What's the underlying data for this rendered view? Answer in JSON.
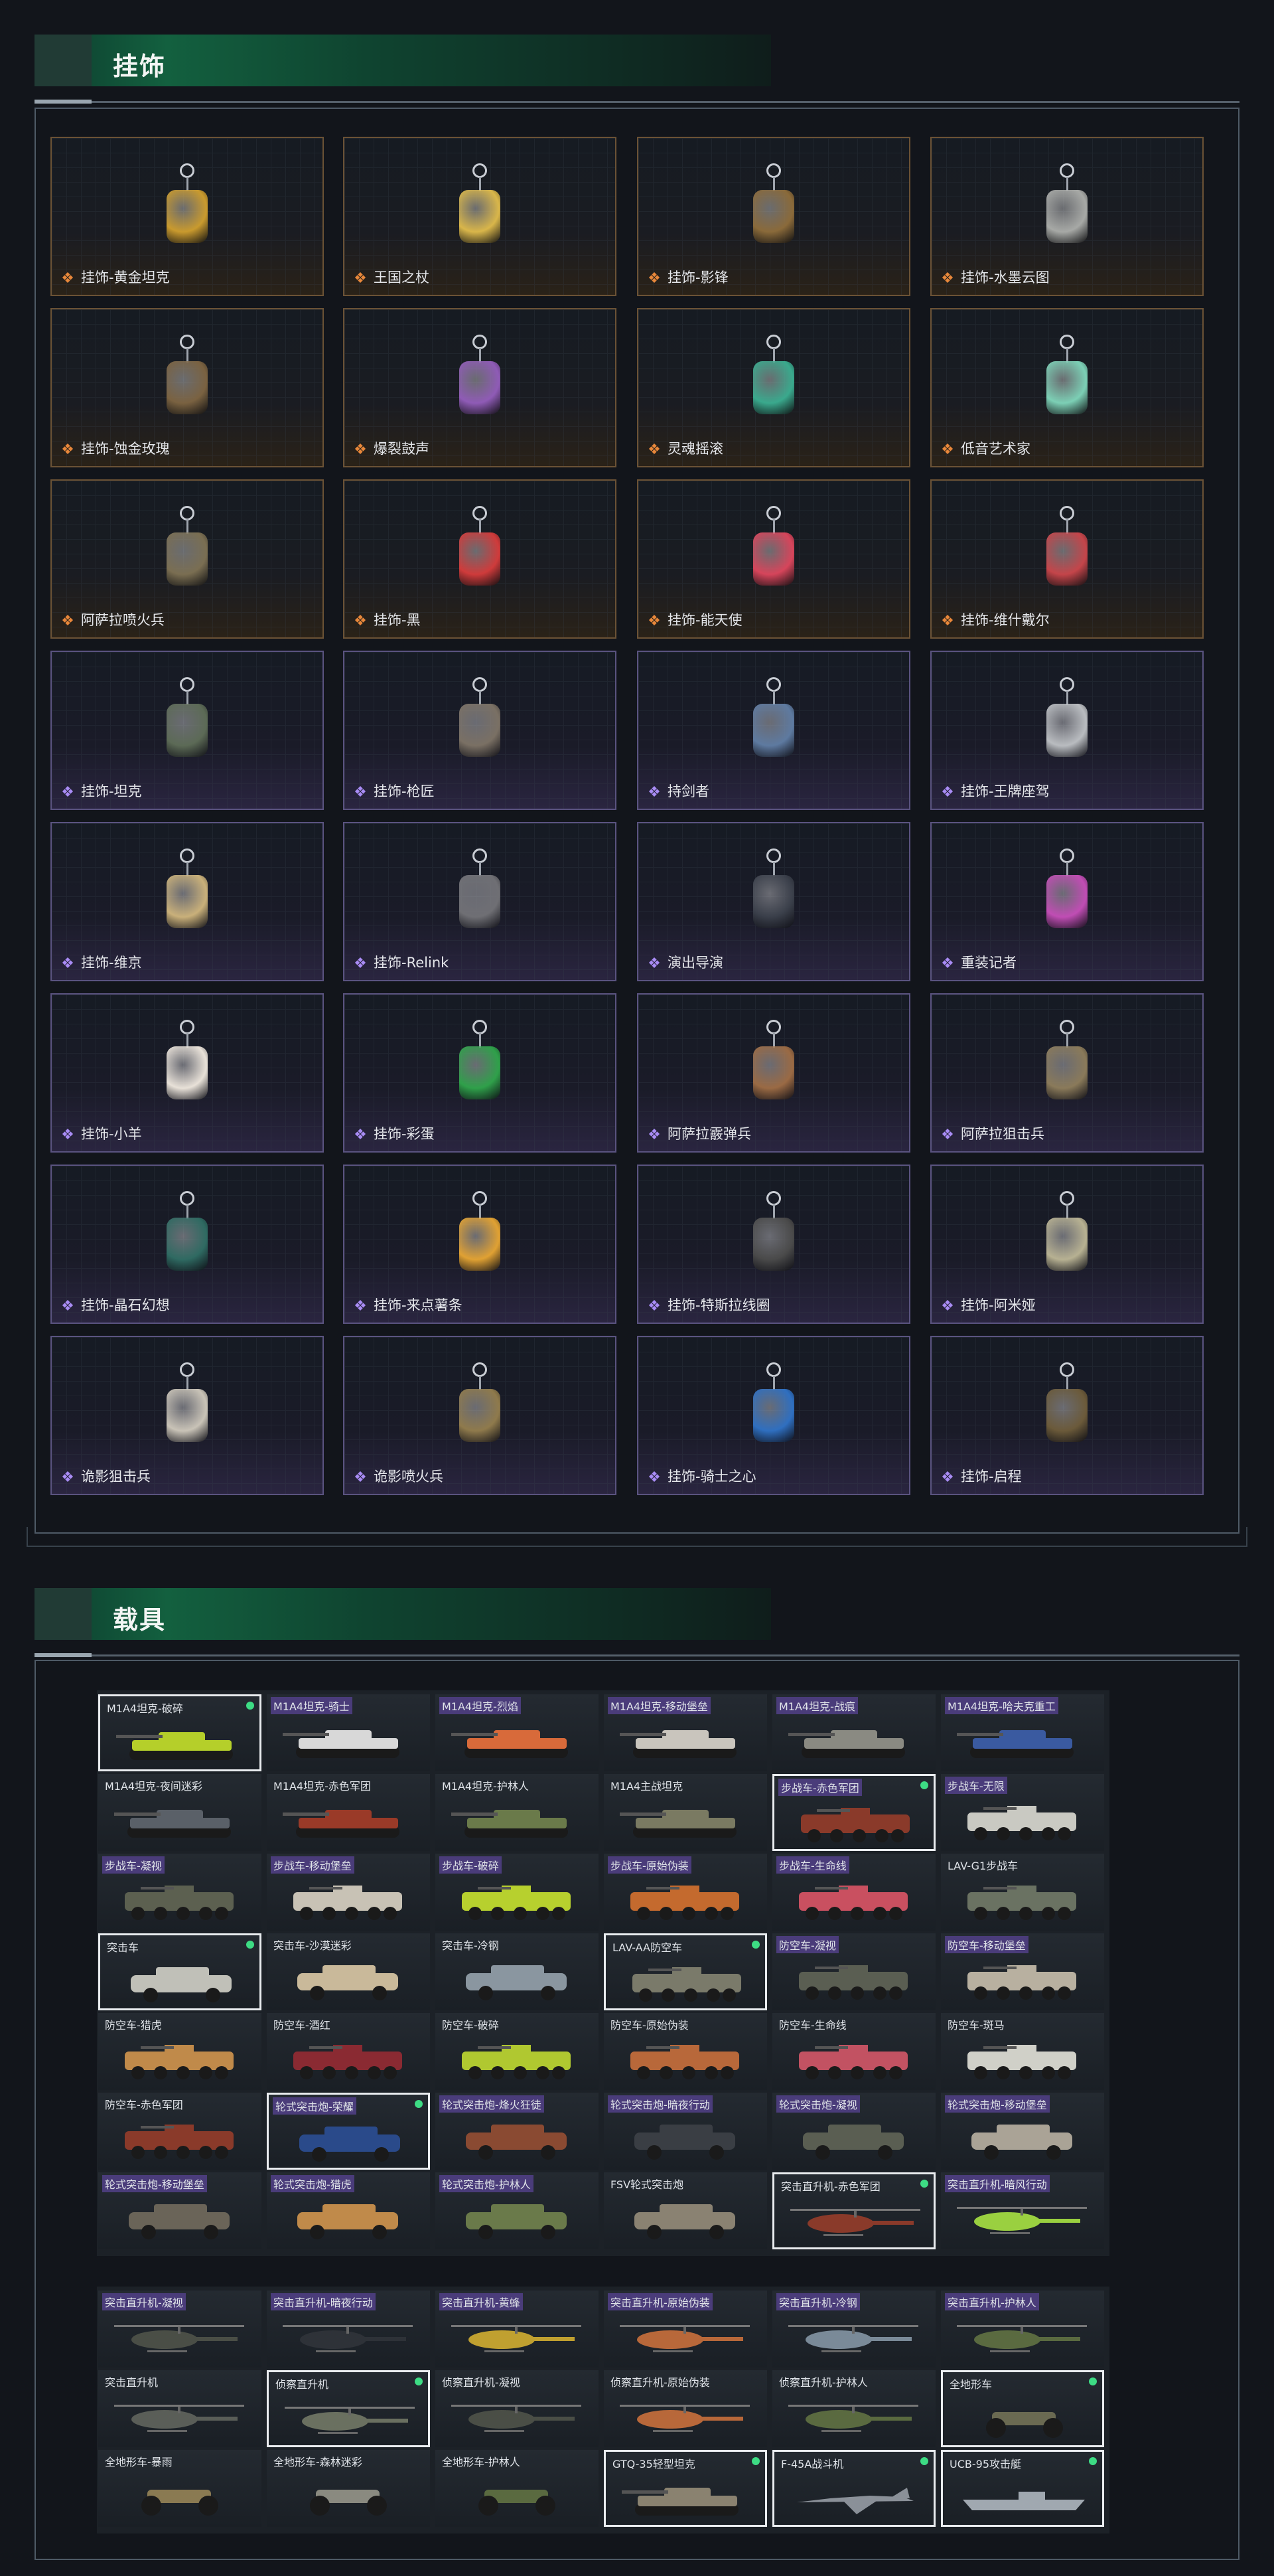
{
  "pendant_section": {
    "title": "挂饰",
    "items": [
      {
        "label": "挂饰-黄金坦克",
        "rarity": "orange",
        "charm": "#c99a2e"
      },
      {
        "label": "王国之杖",
        "rarity": "orange",
        "charm": "#d9b64a"
      },
      {
        "label": "挂饰-影锋",
        "rarity": "orange",
        "charm": "#8a6a3a"
      },
      {
        "label": "挂饰-水墨云图",
        "rarity": "orange",
        "charm": "#a7a9a6"
      },
      {
        "label": "挂饰-蚀金玫瑰",
        "rarity": "orange",
        "charm": "#7a6241"
      },
      {
        "label": "爆裂鼓声",
        "rarity": "orange",
        "charm": "#8f5bb6"
      },
      {
        "label": "灵魂摇滚",
        "rarity": "orange",
        "charm": "#3aa98d"
      },
      {
        "label": "低音艺术家",
        "rarity": "orange",
        "charm": "#7ccfb5"
      },
      {
        "label": "阿萨拉喷火兵",
        "rarity": "orange",
        "charm": "#7a6e52"
      },
      {
        "label": "挂饰-黑",
        "rarity": "orange",
        "charm": "#cf3b3b"
      },
      {
        "label": "挂饰-能天使",
        "rarity": "orange",
        "charm": "#d6455b"
      },
      {
        "label": "挂饰-维什戴尔",
        "rarity": "orange",
        "charm": "#c4454a"
      },
      {
        "label": "挂饰-坦克",
        "rarity": "purple",
        "charm": "#5c6a56"
      },
      {
        "label": "挂饰-枪匠",
        "rarity": "purple",
        "charm": "#7a7064"
      },
      {
        "label": "持剑者",
        "rarity": "purple",
        "charm": "#5e7aa0"
      },
      {
        "label": "挂饰-王牌座驾",
        "rarity": "purple",
        "charm": "#b9bcc0"
      },
      {
        "label": "挂饰-维京",
        "rarity": "purple",
        "charm": "#c9b07a"
      },
      {
        "label": "挂饰-Relink",
        "rarity": "purple",
        "charm": "#6f6f74"
      },
      {
        "label": "演出导演",
        "rarity": "purple",
        "charm": "#3a3f4a"
      },
      {
        "label": "重装记者",
        "rarity": "purple",
        "charm": "#c04db4"
      },
      {
        "label": "挂饰-小羊",
        "rarity": "purple",
        "charm": "#e8e1d8"
      },
      {
        "label": "挂饰-彩蛋",
        "rarity": "purple",
        "charm": "#2fa04a"
      },
      {
        "label": "阿萨拉霰弹兵",
        "rarity": "purple",
        "charm": "#9a6a44"
      },
      {
        "label": "阿萨拉狙击兵",
        "rarity": "purple",
        "charm": "#8a7a5a"
      },
      {
        "label": "挂饰-晶石幻想",
        "rarity": "purple",
        "charm": "#2f6a62"
      },
      {
        "label": "挂饰-来点薯条",
        "rarity": "purple",
        "charm": "#e0a133"
      },
      {
        "label": "挂饰-特斯拉线圈",
        "rarity": "purple",
        "charm": "#4a4a4a"
      },
      {
        "label": "挂饰-阿米娅",
        "rarity": "purple",
        "charm": "#b7b192"
      },
      {
        "label": "诡影狙击兵",
        "rarity": "purple",
        "charm": "#c9c3b7"
      },
      {
        "label": "诡影喷火兵",
        "rarity": "purple",
        "charm": "#8f7a4c"
      },
      {
        "label": "挂饰-骑士之心",
        "rarity": "purple",
        "charm": "#2f6fc0"
      },
      {
        "label": "挂饰-启程",
        "rarity": "purple",
        "charm": "#6b5a3a"
      }
    ]
  },
  "vehicle_section": {
    "title": "载具",
    "ground_vehicles": [
      {
        "label": "M1A4坦克-破碎",
        "tag": "plain",
        "selected": true,
        "dot": true,
        "kind": "tank",
        "color": "#b5cf2a"
      },
      {
        "label": "M1A4坦克-骑士",
        "tag": "purple",
        "selected": false,
        "dot": false,
        "kind": "tank",
        "color": "#d8d8d8"
      },
      {
        "label": "M1A4坦克-烈焰",
        "tag": "purple",
        "selected": false,
        "dot": false,
        "kind": "tank",
        "color": "#d86a3a"
      },
      {
        "label": "M1A4坦克-移动堡垒",
        "tag": "purple",
        "selected": false,
        "dot": false,
        "kind": "tank",
        "color": "#c9c5bd"
      },
      {
        "label": "M1A4坦克-战痕",
        "tag": "purple",
        "selected": false,
        "dot": false,
        "kind": "tank",
        "color": "#8a8a82"
      },
      {
        "label": "M1A4坦克-哈夫克重工",
        "tag": "purple",
        "selected": false,
        "dot": false,
        "kind": "tank",
        "color": "#3a5aa0"
      },
      {
        "label": "M1A4坦克-夜间迷彩",
        "tag": "plain",
        "selected": false,
        "dot": false,
        "kind": "tank",
        "color": "#5a6068"
      },
      {
        "label": "M1A4坦克-赤色军团",
        "tag": "plain",
        "selected": false,
        "dot": false,
        "kind": "tank",
        "color": "#9a3a28"
      },
      {
        "label": "M1A4坦克-护林人",
        "tag": "plain",
        "selected": false,
        "dot": false,
        "kind": "tank",
        "color": "#6a7a4a"
      },
      {
        "label": "M1A4主战坦克",
        "tag": "plain",
        "selected": false,
        "dot": false,
        "kind": "tank",
        "color": "#7a7a62"
      },
      {
        "label": "步战车-赤色军团",
        "tag": "purple",
        "selected": true,
        "dot": true,
        "kind": "ifv",
        "color": "#8a3a2a"
      },
      {
        "label": "步战车-无限",
        "tag": "purple",
        "selected": false,
        "dot": false,
        "kind": "ifv",
        "color": "#c9c9c2"
      },
      {
        "label": "步战车-凝视",
        "tag": "purple",
        "selected": false,
        "dot": false,
        "kind": "ifv",
        "color": "#5c6050"
      },
      {
        "label": "步战车-移动堡垒",
        "tag": "purple",
        "selected": false,
        "dot": false,
        "kind": "ifv",
        "color": "#c8c2b5"
      },
      {
        "label": "步战车-破碎",
        "tag": "purple",
        "selected": false,
        "dot": false,
        "kind": "ifv",
        "color": "#b7d02e"
      },
      {
        "label": "步战车-原始伪装",
        "tag": "purple",
        "selected": false,
        "dot": false,
        "kind": "ifv",
        "color": "#c46a2e"
      },
      {
        "label": "步战车-生命线",
        "tag": "purple",
        "selected": false,
        "dot": false,
        "kind": "ifv",
        "color": "#c95060"
      },
      {
        "label": "LAV-G1步战车",
        "tag": "plain",
        "selected": false,
        "dot": false,
        "kind": "ifv",
        "color": "#6a7262"
      },
      {
        "label": "突击车",
        "tag": "plain",
        "selected": true,
        "dot": true,
        "kind": "car",
        "color": "#c0c0b8"
      },
      {
        "label": "突击车-沙漠迷彩",
        "tag": "plain",
        "selected": false,
        "dot": false,
        "kind": "car",
        "color": "#c9b99a"
      },
      {
        "label": "突击车-冷钢",
        "tag": "plain",
        "selected": false,
        "dot": false,
        "kind": "car",
        "color": "#8a96a0"
      },
      {
        "label": "LAV-AA防空车",
        "tag": "plain",
        "selected": true,
        "dot": true,
        "kind": "ifv",
        "color": "#7a7a6a"
      },
      {
        "label": "防空车-凝视",
        "tag": "purple",
        "selected": false,
        "dot": false,
        "kind": "ifv",
        "color": "#5a5e52"
      },
      {
        "label": "防空车-移动堡垒",
        "tag": "purple",
        "selected": false,
        "dot": false,
        "kind": "ifv",
        "color": "#b8b0a0"
      },
      {
        "label": "防空车-猎虎",
        "tag": "plain",
        "selected": false,
        "dot": false,
        "kind": "ifv",
        "color": "#c08a4a"
      },
      {
        "label": "防空车-酒红",
        "tag": "plain",
        "selected": false,
        "dot": false,
        "kind": "ifv",
        "color": "#8a2a32"
      },
      {
        "label": "防空车-破碎",
        "tag": "plain",
        "selected": false,
        "dot": false,
        "kind": "ifv",
        "color": "#b0c830"
      },
      {
        "label": "防空车-原始伪装",
        "tag": "plain",
        "selected": false,
        "dot": false,
        "kind": "ifv",
        "color": "#b8683a"
      },
      {
        "label": "防空车-生命线",
        "tag": "plain",
        "selected": false,
        "dot": false,
        "kind": "ifv",
        "color": "#c25262"
      },
      {
        "label": "防空车-斑马",
        "tag": "plain",
        "selected": false,
        "dot": false,
        "kind": "ifv",
        "color": "#d0d0c8"
      },
      {
        "label": "防空车-赤色军团",
        "tag": "plain",
        "selected": false,
        "dot": false,
        "kind": "ifv",
        "color": "#8a3a2a"
      },
      {
        "label": "轮式突击炮-荣耀",
        "tag": "purple",
        "selected": true,
        "dot": true,
        "kind": "car",
        "color": "#2a4a8a"
      },
      {
        "label": "轮式突击炮-烽火狂徒",
        "tag": "purple",
        "selected": false,
        "dot": false,
        "kind": "car",
        "color": "#8a4a32"
      },
      {
        "label": "轮式突击炮-暗夜行动",
        "tag": "purple",
        "selected": false,
        "dot": false,
        "kind": "car",
        "color": "#3a3e44"
      },
      {
        "label": "轮式突击炮-凝视",
        "tag": "purple",
        "selected": false,
        "dot": false,
        "kind": "car",
        "color": "#5a5e52"
      },
      {
        "label": "轮式突击炮-移动堡垒",
        "tag": "purple",
        "selected": false,
        "dot": false,
        "kind": "car",
        "color": "#aaa396"
      },
      {
        "label": "轮式突击炮-移动堡垒",
        "tag": "purple",
        "selected": false,
        "dot": false,
        "kind": "car",
        "color": "#6a6458"
      },
      {
        "label": "轮式突击炮-猎虎",
        "tag": "purple",
        "selected": false,
        "dot": false,
        "kind": "car",
        "color": "#c08a4a"
      },
      {
        "label": "轮式突击炮-护林人",
        "tag": "purple",
        "selected": false,
        "dot": false,
        "kind": "car",
        "color": "#6a7a4a"
      },
      {
        "label": "FSV轮式突击炮",
        "tag": "plain",
        "selected": false,
        "dot": false,
        "kind": "car",
        "color": "#8a8272"
      },
      {
        "label": "突击直升机-赤色军团",
        "tag": "plain",
        "selected": true,
        "dot": true,
        "kind": "heli",
        "color": "#8a3a2a"
      },
      {
        "label": "突击直升机-暗风行动",
        "tag": "purple",
        "selected": false,
        "dot": false,
        "kind": "heli",
        "color": "#9ad040"
      }
    ],
    "air_vehicles": [
      {
        "label": "突击直升机-凝视",
        "tag": "purple",
        "selected": false,
        "dot": false,
        "kind": "heli",
        "color": "#4a4e46"
      },
      {
        "label": "突击直升机-暗夜行动",
        "tag": "purple",
        "selected": false,
        "dot": false,
        "kind": "heli",
        "color": "#2e3238"
      },
      {
        "label": "突击直升机-黄蜂",
        "tag": "purple",
        "selected": false,
        "dot": false,
        "kind": "heli",
        "color": "#c0a030"
      },
      {
        "label": "突击直升机-原始伪装",
        "tag": "purple",
        "selected": false,
        "dot": false,
        "kind": "heli",
        "color": "#b8683a"
      },
      {
        "label": "突击直升机-冷钢",
        "tag": "purple",
        "selected": false,
        "dot": false,
        "kind": "heli",
        "color": "#7a8a98"
      },
      {
        "label": "突击直升机-护林人",
        "tag": "purple",
        "selected": false,
        "dot": false,
        "kind": "heli",
        "color": "#5a6a40"
      },
      {
        "label": "突击直升机",
        "tag": "plain",
        "selected": false,
        "dot": false,
        "kind": "heli",
        "color": "#5a5e58"
      },
      {
        "label": "侦察直升机",
        "tag": "plain",
        "selected": true,
        "dot": true,
        "kind": "heli",
        "color": "#6a7060"
      },
      {
        "label": "侦察直升机-凝视",
        "tag": "plain",
        "selected": false,
        "dot": false,
        "kind": "heli",
        "color": "#4a4e46"
      },
      {
        "label": "侦察直升机-原始伪装",
        "tag": "plain",
        "selected": false,
        "dot": false,
        "kind": "heli",
        "color": "#b8683a"
      },
      {
        "label": "侦察直升机-护林人",
        "tag": "plain",
        "selected": false,
        "dot": false,
        "kind": "heli",
        "color": "#5a6a40"
      },
      {
        "label": "全地形车",
        "tag": "plain",
        "selected": true,
        "dot": true,
        "kind": "atv",
        "color": "#6a6a52"
      },
      {
        "label": "全地形车-暴雨",
        "tag": "plain",
        "selected": false,
        "dot": false,
        "kind": "atv",
        "color": "#8a7a52"
      },
      {
        "label": "全地形车-森林迷彩",
        "tag": "plain",
        "selected": false,
        "dot": false,
        "kind": "atv",
        "color": "#8a8a80"
      },
      {
        "label": "全地形车-护林人",
        "tag": "plain",
        "selected": false,
        "dot": false,
        "kind": "atv",
        "color": "#5a6a40"
      },
      {
        "label": "GTQ-35轻型坦克",
        "tag": "plain",
        "selected": true,
        "dot": true,
        "kind": "tank",
        "color": "#8a8270"
      },
      {
        "label": "F-45A战斗机",
        "tag": "plain",
        "selected": true,
        "dot": true,
        "kind": "jet",
        "color": "#8a9098"
      },
      {
        "label": "UCB-95攻击艇",
        "tag": "plain",
        "selected": true,
        "dot": true,
        "kind": "boat",
        "color": "#a0a8b0"
      }
    ]
  }
}
